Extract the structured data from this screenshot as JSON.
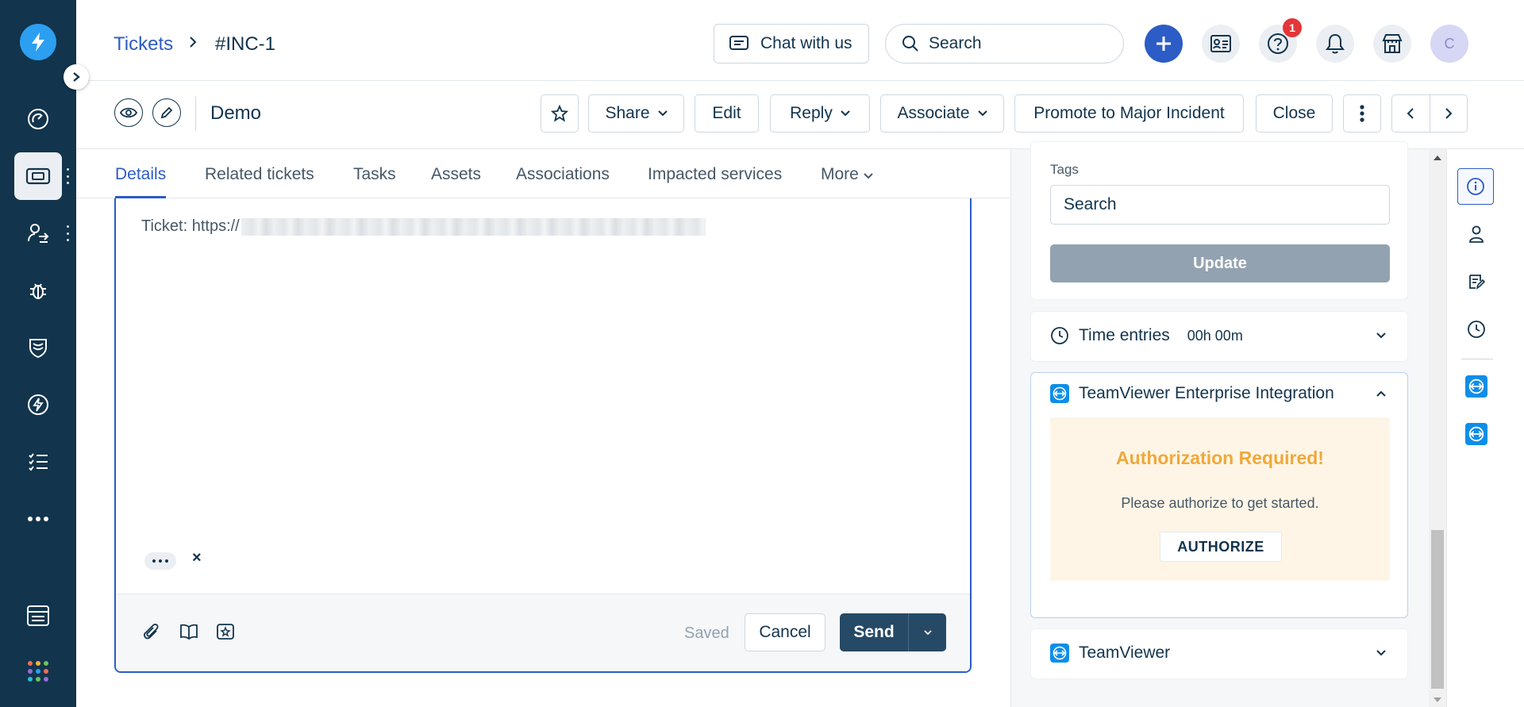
{
  "breadcrumb": {
    "parent": "Tickets",
    "current": "#INC-1"
  },
  "topbar": {
    "chat_label": "Chat with us",
    "search_placeholder": "Search",
    "help_badge": "1",
    "avatar_initial": "C"
  },
  "ticket": {
    "title": "Demo"
  },
  "header_buttons": {
    "share": "Share",
    "edit": "Edit",
    "reply": "Reply",
    "associate": "Associate",
    "promote": "Promote to Major Incident",
    "close": "Close"
  },
  "tabs": {
    "details": "Details",
    "related": "Related tickets",
    "tasks": "Tasks",
    "assets": "Assets",
    "associations": "Associations",
    "impacted": "Impacted services",
    "more": "More"
  },
  "editor": {
    "ticket_prefix": "Ticket: https://",
    "saved_label": "Saved",
    "cancel_label": "Cancel",
    "send_label": "Send"
  },
  "right_panel": {
    "tags_label": "Tags",
    "tags_placeholder": "Search",
    "update_label": "Update",
    "time_entries_label": "Time entries",
    "time_entries_value": "00h 00m",
    "tv_enterprise_title": "TeamViewer Enterprise Integration",
    "auth_title": "Authorization Required!",
    "auth_text": "Please authorize to get started.",
    "auth_button": "AUTHORIZE",
    "teamviewer_title": "TeamViewer"
  },
  "colors": {
    "nav_bg": "#12344d",
    "accent": "#2c5cc5",
    "auth_title": "#f0a83a",
    "auth_bg": "#fef5e6",
    "badge": "#e43538"
  },
  "icons": {
    "left_nav": [
      "logo-bolt-icon",
      "dashboard-icon",
      "tickets-icon",
      "changes-icon",
      "problems-icon",
      "releases-icon",
      "alerts-icon",
      "tasks-list-icon",
      "more-icon",
      "admin-icon",
      "apps-grid-icon"
    ],
    "rail": [
      "info-icon",
      "person-icon",
      "notes-icon",
      "clock-icon",
      "teamviewer-icon",
      "teamviewer-icon"
    ]
  }
}
